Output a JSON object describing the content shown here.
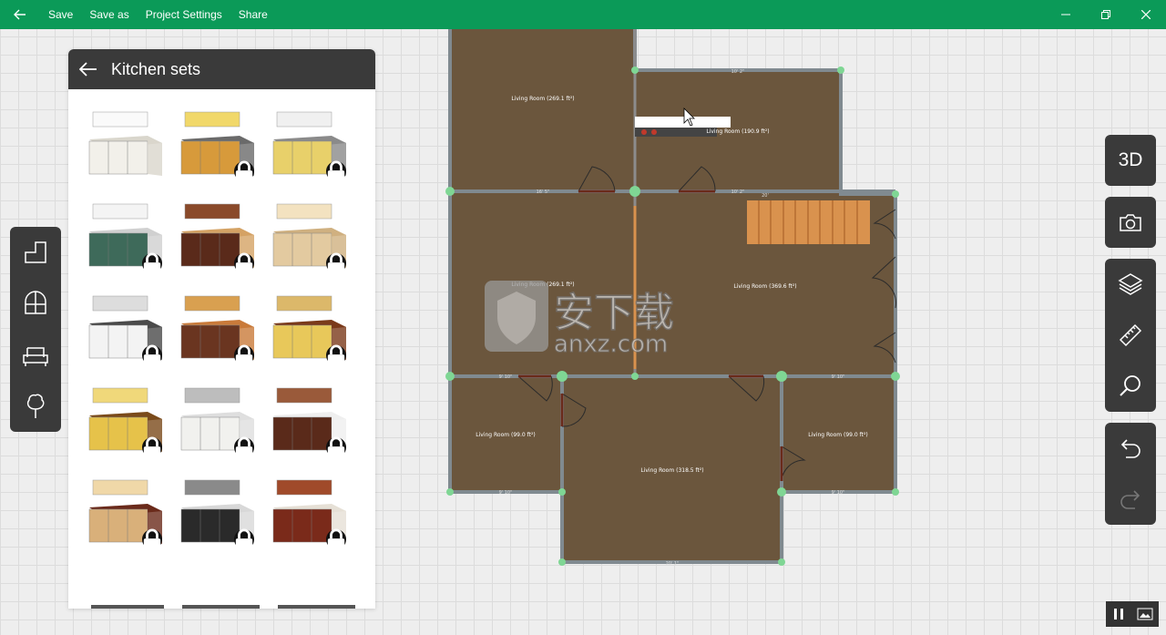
{
  "titlebar": {
    "menu": [
      "Save",
      "Save as",
      "Project Settings",
      "Share"
    ],
    "bg": "#0b9a58"
  },
  "catalog": {
    "title": "Kitchen sets",
    "items": [
      {
        "name": "white-kitchen",
        "locked": false
      },
      {
        "name": "wood-kitchen",
        "locked": true
      },
      {
        "name": "yellow-island",
        "locked": true
      },
      {
        "name": "green-corner-kitchen",
        "locked": true
      },
      {
        "name": "dark-wood-kitchen",
        "locked": true
      },
      {
        "name": "classic-hood-kitchen",
        "locked": true
      },
      {
        "name": "white-bar-kitchen",
        "locked": true
      },
      {
        "name": "walnut-kitchen",
        "locked": true
      },
      {
        "name": "yellow-cabinet-kitchen",
        "locked": true
      },
      {
        "name": "yellow-tall-cabinet",
        "locked": true
      },
      {
        "name": "white-classic-kitchen",
        "locked": true
      },
      {
        "name": "modern-hood-kitchen",
        "locked": true
      },
      {
        "name": "beige-corner-kitchen",
        "locked": true
      },
      {
        "name": "black-steel-kitchen",
        "locked": true
      },
      {
        "name": "red-wood-kitchen",
        "locked": true
      }
    ]
  },
  "toolrail": [
    "wall-tool-icon",
    "window-tool-icon",
    "furniture-sofa-icon",
    "tree-plant-icon"
  ],
  "righttools": {
    "view3d": "3D"
  },
  "floorplan": {
    "rooms": [
      "Living Room (269.1 ft²)",
      "Living Room (190.9 ft²)",
      "Living Room (269.1 ft²)",
      "Living Room (369.6 ft²)",
      "Living Room (99.0 ft²)",
      "Living Room (318.5 ft²)",
      "Living Room (99.0 ft²)"
    ],
    "dims": [
      "10' 2\"",
      "16' 5\"",
      "10' 2\"",
      "20'",
      "9' 10\"",
      "9' 10\"",
      "9' 10\"",
      "9' 10\"",
      "20' 1\""
    ]
  },
  "watermark": {
    "text": "安下载",
    "sub": "anxz.com"
  },
  "colors": {
    "floor": "#6b563d",
    "wall": "#808a90",
    "node": "#7fd694",
    "stairs": "#d9924e",
    "accent": "#0b9a58"
  }
}
